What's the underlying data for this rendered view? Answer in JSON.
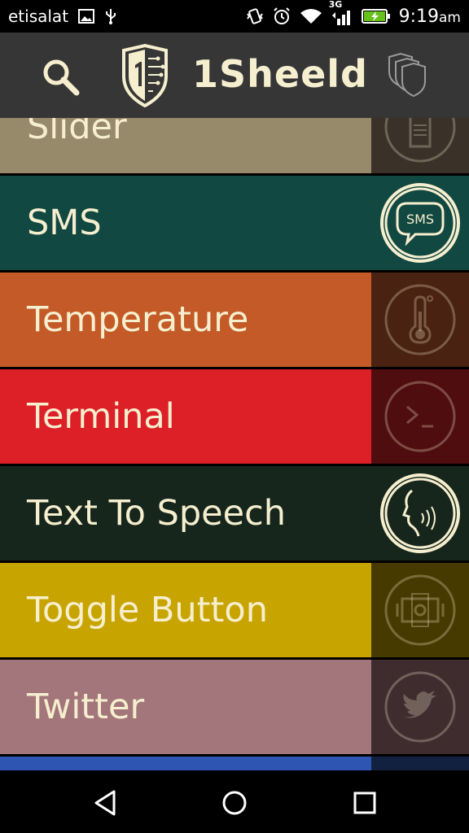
{
  "status": {
    "carrier": "etisalat",
    "network": "3G",
    "time": "9:19",
    "ampm": "am"
  },
  "app_bar": {
    "title": "1Sheeld",
    "logo_numeral": "1"
  },
  "items": [
    {
      "label": "Slider",
      "bg": "#978a6a",
      "panel": "#3a3128",
      "icon": "slider-icon",
      "active": false
    },
    {
      "label": "SMS",
      "bg": "#114842",
      "panel": "#114842",
      "icon": "sms-icon",
      "active": true,
      "icon_text": "SMS"
    },
    {
      "label": "Temperature",
      "bg": "#c45a27",
      "panel": "#4a2211",
      "icon": "thermometer-icon",
      "active": false
    },
    {
      "label": "Terminal",
      "bg": "#dd1f27",
      "panel": "#500d0f",
      "icon": "terminal-icon",
      "active": false
    },
    {
      "label": "Text To Speech",
      "bg": "#17261c",
      "panel": "#17261c",
      "icon": "speech-icon",
      "active": true
    },
    {
      "label": "Toggle Button",
      "bg": "#c8a400",
      "panel": "#473a00",
      "icon": "toggle-icon",
      "active": false
    },
    {
      "label": "Twitter",
      "bg": "#a3767b",
      "panel": "#3e2c2e",
      "icon": "twitter-icon",
      "active": false
    },
    {
      "label": "",
      "bg": "#2f55b3",
      "panel": "#12213f",
      "icon": "",
      "active": false
    }
  ],
  "colors": {
    "cream": "#f6efcf",
    "appbar": "#363636"
  }
}
